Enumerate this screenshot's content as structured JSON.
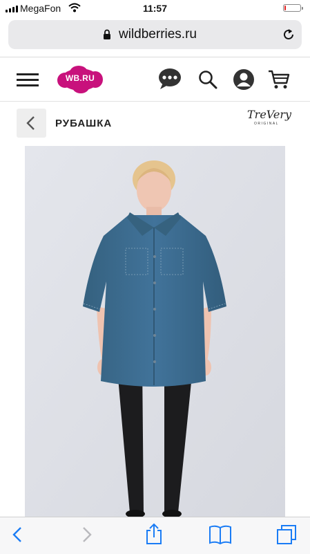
{
  "status_bar": {
    "carrier": "MegaFon",
    "time": "11:57",
    "battery_level": 0.1,
    "battery_color": "#e02020"
  },
  "browser": {
    "url": "wildberries.ru",
    "icons": [
      "lock-icon",
      "reload-icon"
    ]
  },
  "site_header": {
    "logo_text": "WB.RU",
    "brand_color": "#c8117c",
    "icons": [
      "hamburger-menu-icon",
      "chat-icon",
      "search-icon",
      "user-icon",
      "cart-icon"
    ]
  },
  "product": {
    "title": "РУБАШКА",
    "brand_name": "TreVery",
    "brand_sub": "ORIGINAL"
  },
  "toolbar": {
    "icons": [
      "back-arrow-icon",
      "forward-arrow-icon",
      "share-icon",
      "bookmarks-icon",
      "tabs-icon"
    ],
    "accent_color": "#1a7cf5"
  }
}
